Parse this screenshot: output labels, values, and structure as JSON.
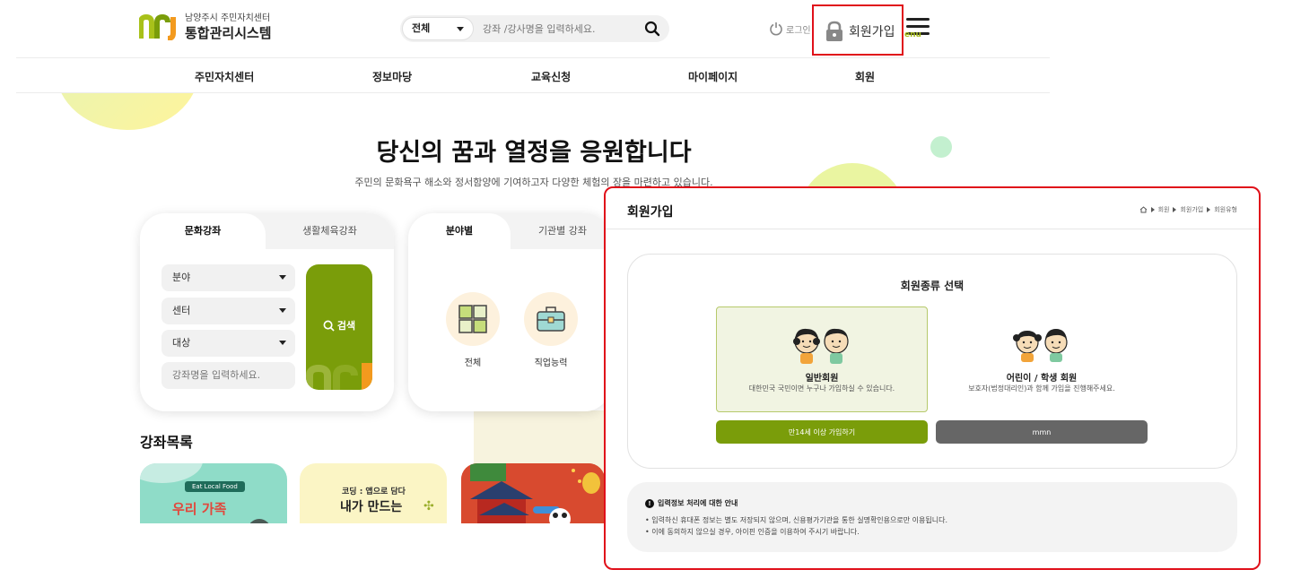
{
  "header": {
    "logo_sub": "남양주시 주민자치센터",
    "logo_main": "통합관리시스템",
    "search_select": "전체",
    "search_placeholder": "강좌 /강사명을 입력하세요.",
    "login_label": "로그인",
    "join_label": "회원가입",
    "menu_label": "enu"
  },
  "gnb": [
    "주민자치센터",
    "정보마당",
    "교육신청",
    "마이페이지",
    "회원"
  ],
  "hero": {
    "title": "당신의 꿈과 열정을 응원합니다",
    "subtitle": "주민의 문화욕구 해소와 정서함양에 기여하고자 다양한 체험의 장을 마련하고 있습니다."
  },
  "search_card": {
    "tabs": [
      "문화강좌",
      "생활체육강좌"
    ],
    "selects": [
      "분야",
      "센터",
      "대상"
    ],
    "keyword_placeholder": "강좌명을 입력하세요.",
    "search_label": "검색"
  },
  "category_card": {
    "tabs": [
      "분야별",
      "기관별 강좌"
    ],
    "items": [
      "전체",
      "직업능력"
    ]
  },
  "course_list": {
    "heading": "강좌목록",
    "thumb1_badge": "Eat Local Food",
    "thumb1_title": "우리 가족",
    "thumb2_sub": "코딩 : 앱으로 담다",
    "thumb2_title": "내가 만드는"
  },
  "modal": {
    "title": "회원가입",
    "breadcrumb": [
      "회원",
      "회원가입",
      "회원유형"
    ],
    "types_title": "회원종류 선택",
    "general_name": "일반회원",
    "general_desc": "대한민국 국민이면 누구나 가입하실 수 있습니다.",
    "child_name": "어린이 / 학생 회원",
    "child_desc": "보호자(법정대리인)과 함께 가입을 진행해주세요.",
    "adult_button": "만14세 이상 가입하기",
    "child_button": "mmn",
    "notice_title": "입력정보 처리에 대한 안내",
    "notice_lines": [
      "• 입력하신 휴대폰 정보는 별도 저장되지 않으며, 신용평가기관을 통한 실명확인용으로만 이용됩니다.",
      "• 이에 동의하지 않으실 경우, 아이핀 인증을 이용하여 주시기 바랍니다."
    ]
  },
  "colors": {
    "accent_green": "#7a9d0a",
    "highlight_red": "#e0101a",
    "gray_button": "#666666"
  }
}
